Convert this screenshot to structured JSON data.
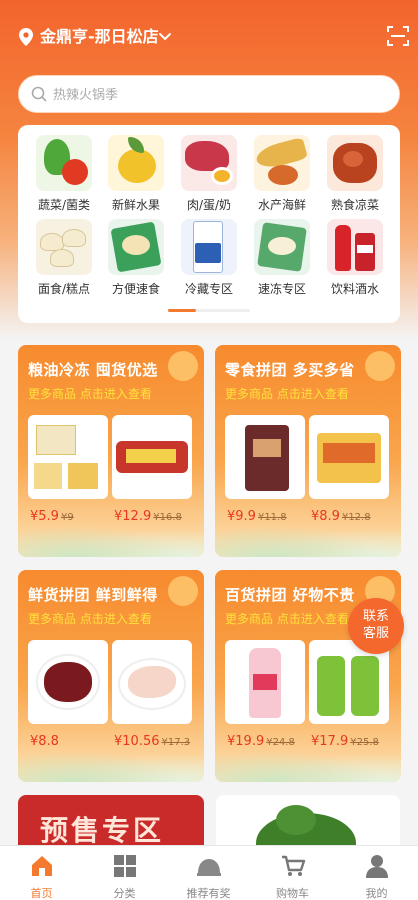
{
  "header": {
    "store_name": "金鼎亨-那日松店"
  },
  "search": {
    "placeholder": "热辣火锅季"
  },
  "categories": [
    {
      "label": "蔬菜/菌类"
    },
    {
      "label": "新鲜水果"
    },
    {
      "label": "肉/蛋/奶"
    },
    {
      "label": "水产海鲜"
    },
    {
      "label": "熟食凉菜"
    },
    {
      "label": "面食/糕点"
    },
    {
      "label": "方便速食"
    },
    {
      "label": "冷藏专区"
    },
    {
      "label": "速冻专区"
    },
    {
      "label": "饮料酒水"
    }
  ],
  "promos": [
    {
      "title": "粮油冷冻 囤货优选",
      "subtitle": "更多商品 点击进入查看",
      "items": [
        {
          "price": "¥5.9",
          "orig": "¥9"
        },
        {
          "price": "¥12.9",
          "orig": "¥16.8"
        }
      ]
    },
    {
      "title": "零食拼团 多买多省",
      "subtitle": "更多商品 点击进入查看",
      "items": [
        {
          "price": "¥9.9",
          "orig": "¥11.8"
        },
        {
          "price": "¥8.9",
          "orig": "¥12.8"
        }
      ]
    },
    {
      "title": "鲜货拼团 鲜到鲜得",
      "subtitle": "更多商品 点击进入查看",
      "items": [
        {
          "price": "¥8.8",
          "orig": ""
        },
        {
          "price": "¥10.56",
          "orig": "¥17.3"
        }
      ]
    },
    {
      "title": "百货拼团 好物不贵",
      "subtitle": "更多商品 点击进入查看",
      "items": [
        {
          "price": "¥19.9",
          "orig": "¥24.8"
        },
        {
          "price": "¥17.9",
          "orig": "¥25.8"
        }
      ]
    }
  ],
  "float_service": {
    "line1": "联系",
    "line2": "客服"
  },
  "presale": {
    "label": "预售专区"
  },
  "tabs": [
    {
      "label": "首页"
    },
    {
      "label": "分类"
    },
    {
      "label": "推荐有奖"
    },
    {
      "label": "购物车"
    },
    {
      "label": "我的"
    }
  ],
  "colors": {
    "accent": "#f47a2f",
    "price": "#e8381e"
  }
}
